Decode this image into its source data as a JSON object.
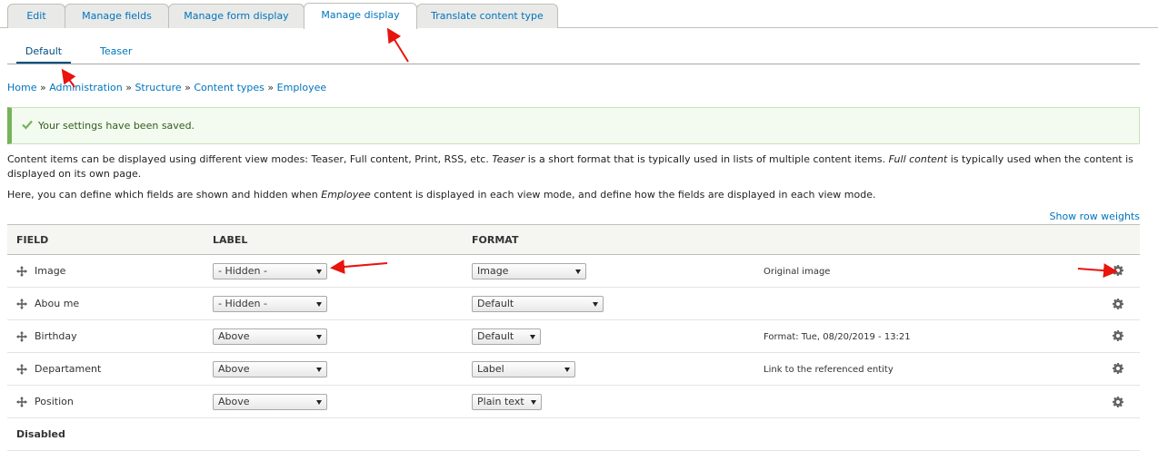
{
  "primary_tabs": [
    {
      "label": "Edit"
    },
    {
      "label": "Manage fields"
    },
    {
      "label": "Manage form display"
    },
    {
      "label": "Manage display"
    },
    {
      "label": "Translate content type"
    }
  ],
  "secondary_tabs": [
    {
      "label": "Default"
    },
    {
      "label": "Teaser"
    }
  ],
  "breadcrumb": {
    "items": [
      "Home",
      "Administration",
      "Structure",
      "Content types",
      "Employee"
    ],
    "separator": "»"
  },
  "message": {
    "text": "Your settings have been saved."
  },
  "description": {
    "line1_a": "Content items can be displayed using different view modes: Teaser, Full content, Print, RSS, etc. ",
    "line1_em1": "Teaser",
    "line1_b": " is a short format that is typically used in lists of multiple content items. ",
    "line1_em2": "Full content",
    "line1_c": " is typically used when the content is displayed on its own page.",
    "line2_a": "Here, you can define which fields are shown and hidden when ",
    "line2_em": "Employee",
    "line2_b": " content is displayed in each view mode, and define how the fields are displayed in each view mode."
  },
  "show_row_weights": "Show row weights",
  "table": {
    "headers": {
      "field": "Field",
      "label": "Label",
      "format": "Format"
    },
    "rows": [
      {
        "field": "Image",
        "label": "- Hidden -",
        "format": "Image",
        "summary": "Original image"
      },
      {
        "field": "Abou me",
        "label": "- Hidden -",
        "format": "Default",
        "summary": ""
      },
      {
        "field": "Birthday",
        "label": "Above",
        "format": "Default",
        "summary": "Format: Tue, 08/20/2019 - 13:21"
      },
      {
        "field": "Departament",
        "label": "Above",
        "format": "Label",
        "summary": "Link to the referenced entity"
      },
      {
        "field": "Position",
        "label": "Above",
        "format": "Plain text",
        "summary": ""
      }
    ],
    "disabled_label": "Disabled"
  },
  "icons": {
    "drag": "move-cross-icon",
    "gear": "gear-icon",
    "check": "checkmark-icon"
  },
  "colors": {
    "link": "#0074bd",
    "success_border": "#77b259",
    "annotation_arrow": "#e8140e"
  }
}
